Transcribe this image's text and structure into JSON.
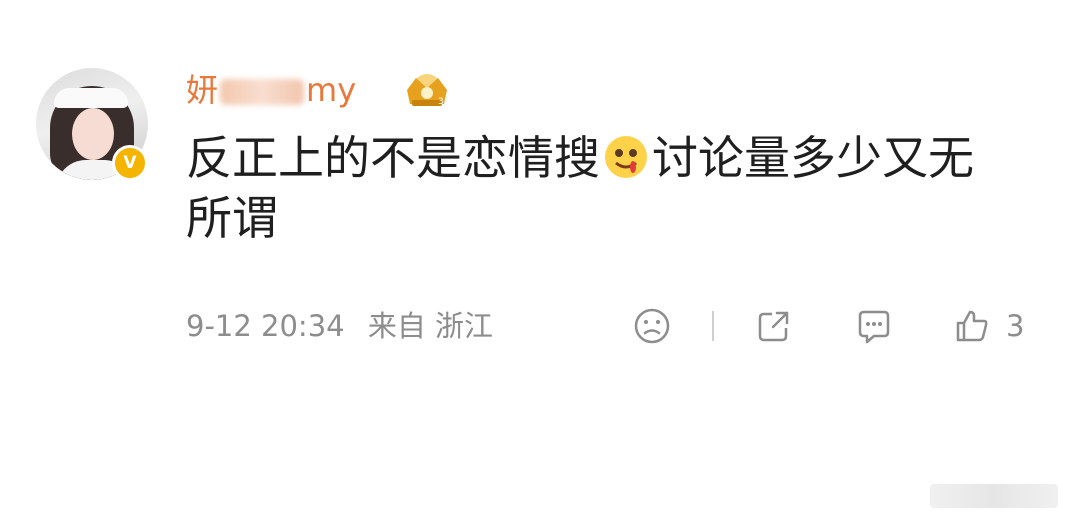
{
  "comment": {
    "username_prefix": "妍",
    "username_suffix": "my",
    "text_before_emoji": "反正上的不是恋情搜",
    "text_after_emoji": "讨论量多少又无所谓",
    "date": "9-12 20:34",
    "source": "来自 浙江",
    "like_count": "3"
  },
  "icons": {
    "verified": "V",
    "emoji": "drooling-face-emoji",
    "crown": "crown-badge-icon",
    "dislike": "sad-face-icon",
    "share": "share-icon",
    "reply": "comment-icon",
    "like": "thumbs-up-icon"
  },
  "colors": {
    "username": "#e8793a",
    "meta": "#8d8d8d",
    "badge": "#f5b400"
  }
}
